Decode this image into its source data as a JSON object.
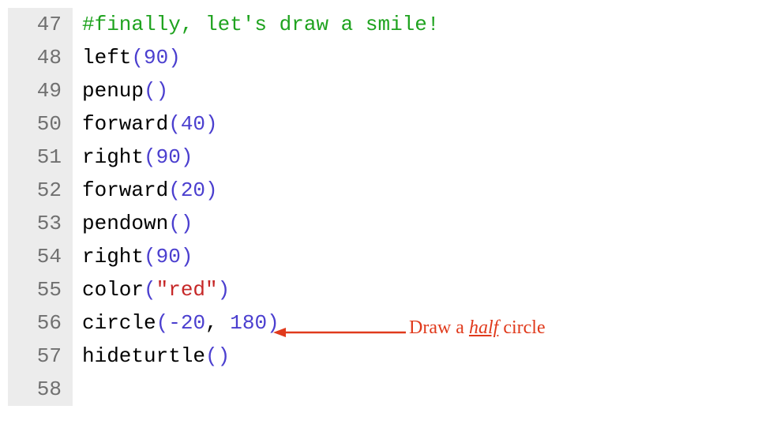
{
  "colors": {
    "gutter_bg": "#ececec",
    "gutter_fg": "#707070",
    "comment": "#1fa31f",
    "paren_number": "#4b3fcf",
    "string": "#c62828",
    "annotation": "#e03a1c"
  },
  "lines": [
    {
      "num": "47",
      "tokens": {
        "comment": "#finally, let's draw a smile!"
      }
    },
    {
      "num": "48",
      "tokens": {
        "func": "left",
        "open": "(",
        "arg_num": "90",
        "close": ")"
      }
    },
    {
      "num": "49",
      "tokens": {
        "func": "penup",
        "open": "(",
        "close": ")"
      }
    },
    {
      "num": "50",
      "tokens": {
        "func": "forward",
        "open": "(",
        "arg_num": "40",
        "close": ")"
      }
    },
    {
      "num": "51",
      "tokens": {
        "func": "right",
        "open": "(",
        "arg_num": "90",
        "close": ")"
      }
    },
    {
      "num": "52",
      "tokens": {
        "func": "forward",
        "open": "(",
        "arg_num": "20",
        "close": ")"
      }
    },
    {
      "num": "53",
      "tokens": {
        "func": "pendown",
        "open": "(",
        "close": ")"
      }
    },
    {
      "num": "54",
      "tokens": {
        "func": "right",
        "open": "(",
        "arg_num": "90",
        "close": ")"
      }
    },
    {
      "num": "55",
      "tokens": {
        "func": "color",
        "open": "(",
        "arg_str": "\"red\"",
        "close": ")"
      }
    },
    {
      "num": "56",
      "tokens": {
        "func": "circle",
        "open": "(",
        "arg_num": "-20",
        "sep": ", ",
        "arg_num_2": "180",
        "close": ")"
      }
    },
    {
      "num": "57",
      "tokens": {
        "func": "hideturtle",
        "open": "(",
        "close": ")"
      }
    },
    {
      "num": "58",
      "tokens": {}
    }
  ],
  "annotation": {
    "prefix": "Draw a ",
    "underlined": "half",
    "suffix": " circle"
  }
}
